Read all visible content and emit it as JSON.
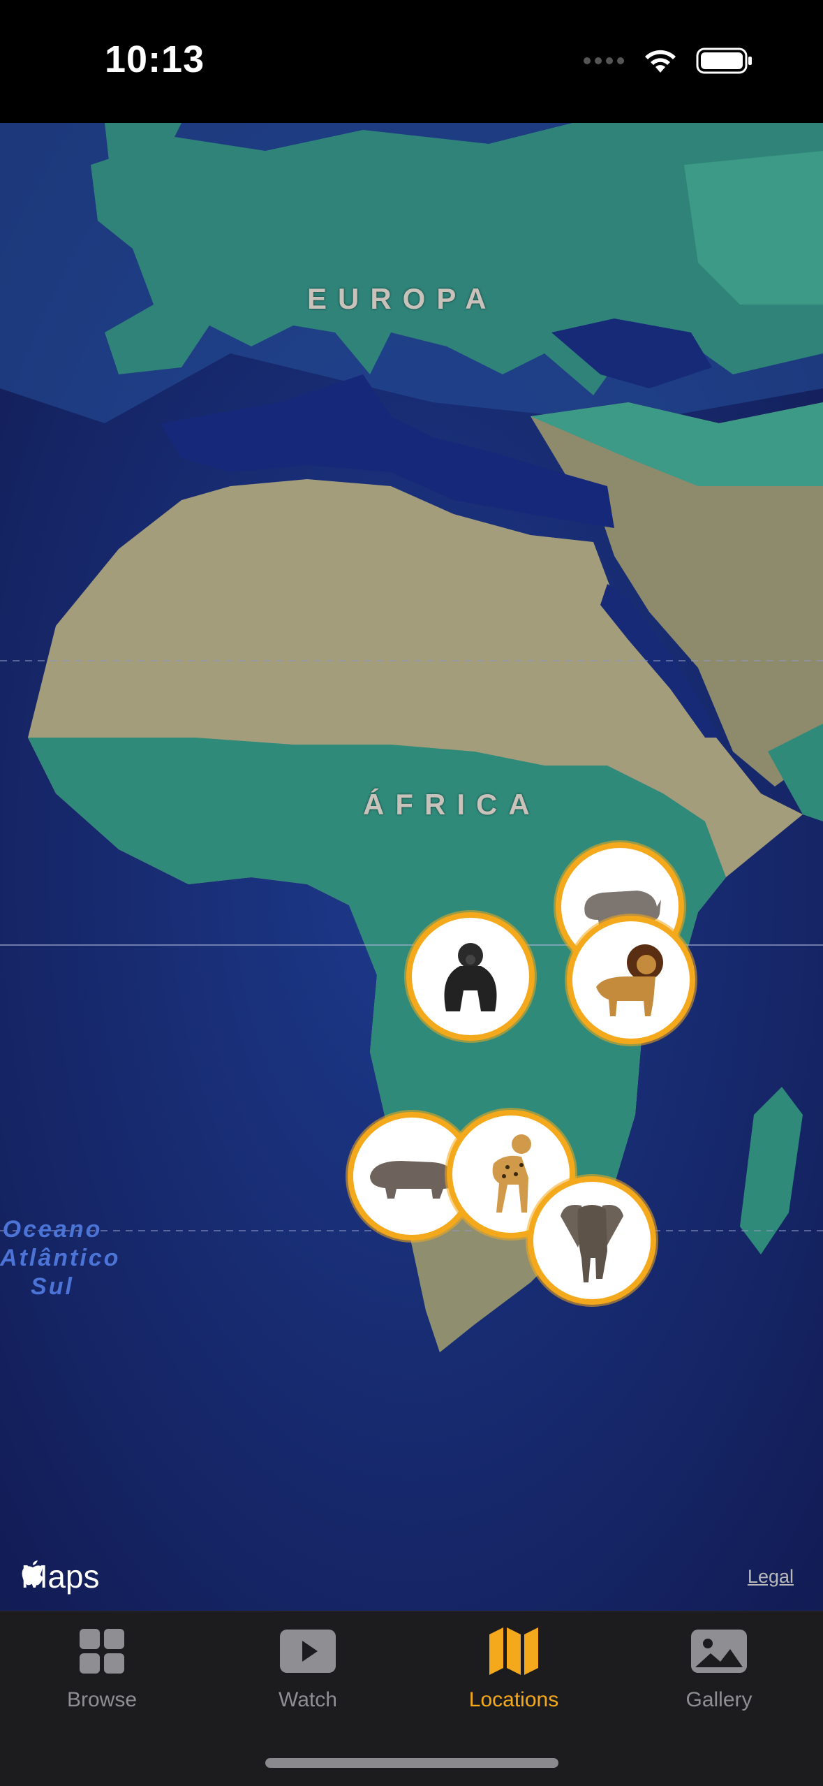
{
  "status_bar": {
    "time": "10:13"
  },
  "map": {
    "labels": {
      "europe": "EUROPA",
      "africa": "ÁFRICA",
      "ocean": "Oceano\nAtlântico\nSul"
    },
    "markers": [
      {
        "animal": "rhino"
      },
      {
        "animal": "gorilla"
      },
      {
        "animal": "lion"
      },
      {
        "animal": "hippo"
      },
      {
        "animal": "cheetah"
      },
      {
        "animal": "elephant"
      }
    ],
    "attribution": "Maps",
    "legal": "Legal"
  },
  "tabs": [
    {
      "label": "Browse",
      "icon": "grid-icon"
    },
    {
      "label": "Watch",
      "icon": "play-icon"
    },
    {
      "label": "Locations",
      "icon": "map-icon",
      "active": true
    },
    {
      "label": "Gallery",
      "icon": "photo-icon"
    }
  ],
  "colors": {
    "accent": "#f4a91c",
    "tabbar": "#1c1c1e",
    "ocean": "#1a2a6b"
  }
}
